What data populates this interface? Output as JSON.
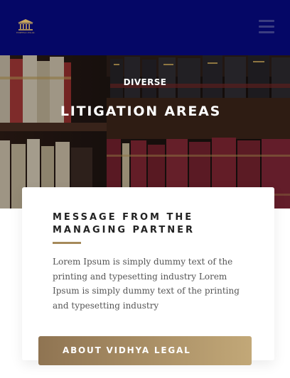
{
  "brand": {
    "logo_text": "VIDHYA LEGAL",
    "logo_icon": "courthouse-icon",
    "accent_color": "#c9a85c"
  },
  "nav": {
    "menu_icon": "hamburger-menu-icon",
    "background": "#050766"
  },
  "hero": {
    "eyebrow": "DIVERSE",
    "title": "LITIGATION AREAS",
    "background_image": "law-books-shelf"
  },
  "message_card": {
    "heading": "MESSAGE FROM THE MANAGING PARTNER",
    "body": "Lorem Ipsum is simply dummy text of the printing and typesetting industry Lorem Ipsum is simply dummy text of the printing and typesetting industry",
    "rule_color": "#a58a5b"
  },
  "cta": {
    "label": "ABOUT VIDHYA LEGAL"
  }
}
